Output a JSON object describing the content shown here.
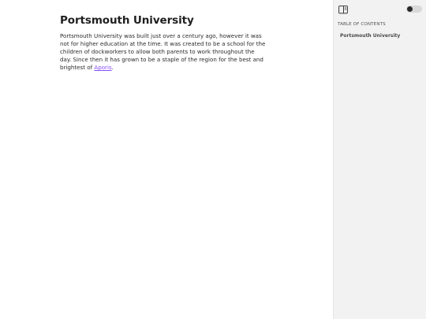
{
  "article": {
    "title": "Portsmouth University",
    "body_text": "Portsmouth University was built just over a century ago, however it was not for higher education at the time. It was created to be a school for the children of dockworkers to allow both parents to work throughout the day. Since then it has grown to be a staple of the region for the best and brightest of ",
    "link_text": "Aporis",
    "trailing_text": "."
  },
  "sidebar": {
    "toc_heading": "TABLE OF CONTENTS",
    "toc_items": [
      {
        "label": "Portsmouth University"
      }
    ],
    "panel_toggle_icon": "sidebar-panel-icon",
    "theme_toggle": {
      "state": "off"
    }
  },
  "colors": {
    "link": "#8a4fff",
    "sidebar_bg": "#f2f2f2",
    "title": "#1f1f1f"
  }
}
